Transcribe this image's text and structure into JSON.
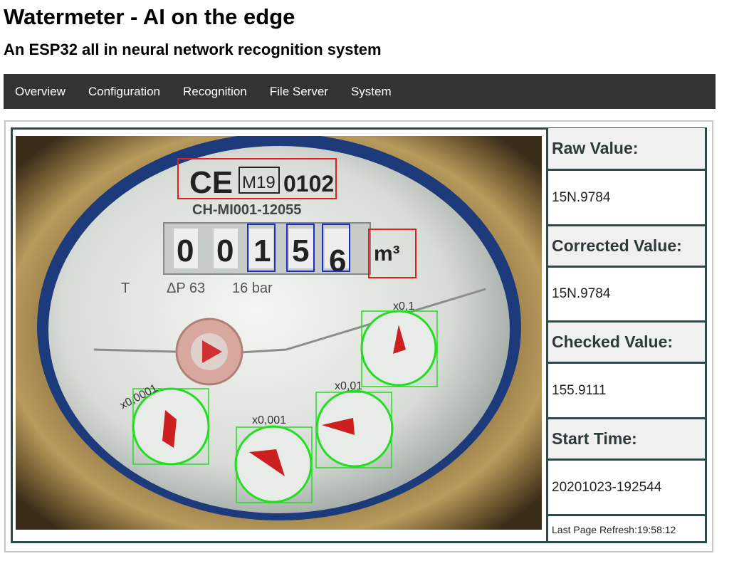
{
  "header": {
    "title": "Watermeter - AI on the edge",
    "subtitle": "An ESP32 all in neural network recognition system"
  },
  "nav": {
    "items": [
      {
        "label": "Overview"
      },
      {
        "label": "Configuration"
      },
      {
        "label": "Recognition"
      },
      {
        "label": "File Server"
      },
      {
        "label": "System"
      }
    ]
  },
  "meter": {
    "ce_mark": "CE",
    "cert": "M19",
    "cert_number": "0102",
    "model": "CH-MI001-12055",
    "digits": [
      "0",
      "0",
      "1",
      "5",
      "6"
    ],
    "unit": "m³",
    "spec_t": "T",
    "spec_dp": "ΔP 63",
    "spec_bar": "16 bar",
    "dial_0_1": "x0,1",
    "dial_0_01": "x0,01",
    "dial_0_001": "x0,001",
    "dial_0_0001": "x0,0001"
  },
  "values": {
    "raw_label": "Raw Value:",
    "raw": "15N.9784",
    "corrected_label": "Corrected Value:",
    "corrected": "15N.9784",
    "checked_label": "Checked Value:",
    "checked": "155.9111",
    "start_label": "Start Time:",
    "start": "20201023-192544",
    "refresh": "Last Page Refresh:19:58:12"
  },
  "colors": {
    "nav_bg": "#333333",
    "table_border": "#2e4a4a",
    "roi_red": "#e02020",
    "roi_blue": "#1a2ec8",
    "roi_green": "#22dd22",
    "dial_red": "#cc2020"
  }
}
